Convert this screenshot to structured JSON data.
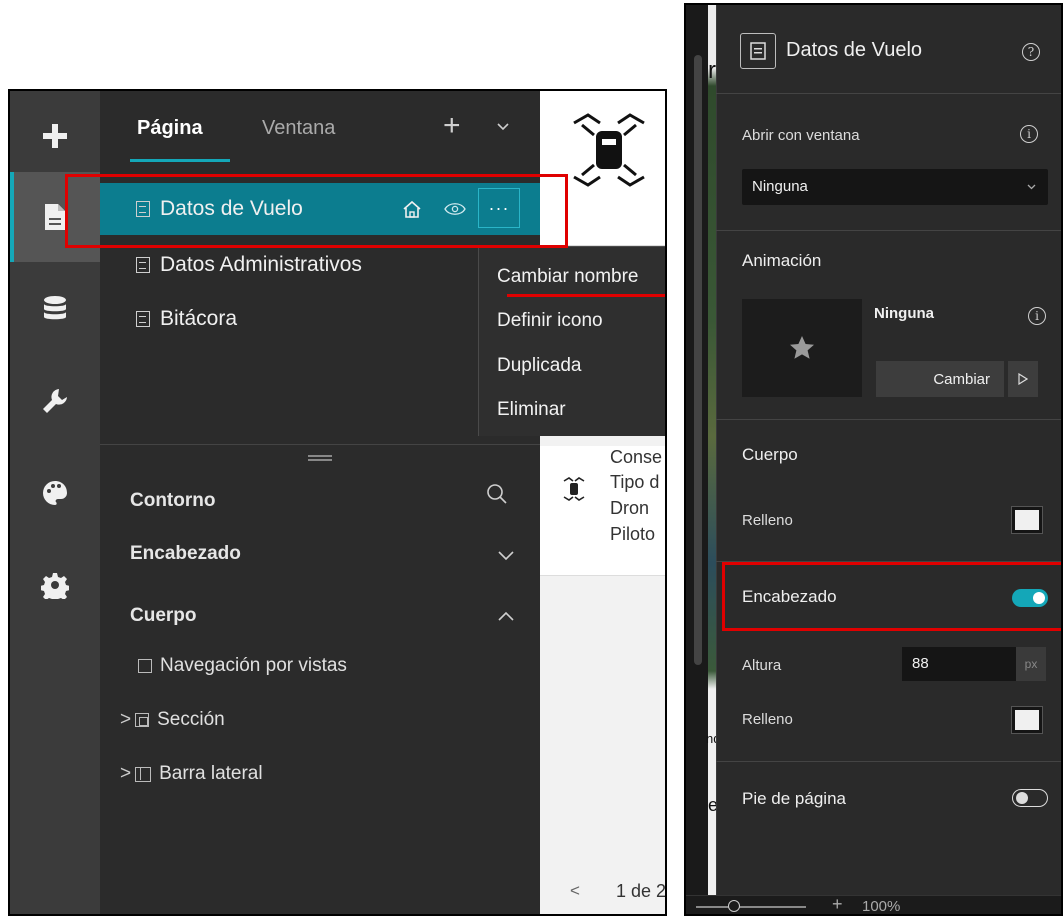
{
  "left_panel": {
    "tabs": {
      "page": "Página",
      "window": "Ventana"
    },
    "pages": [
      {
        "label": "Datos de Vuelo"
      },
      {
        "label": "Datos Administrativos"
      },
      {
        "label": "Bitácora"
      }
    ],
    "more_label": "···",
    "context_menu": [
      "Cambiar nombre",
      "Definir icono",
      "Duplicada",
      "Eliminar"
    ],
    "outline": {
      "title": "Contorno",
      "header": "Encabezado",
      "body": "Cuerpo",
      "items": [
        {
          "label": "Navegación por vistas"
        },
        {
          "label": "Sección"
        },
        {
          "label": "Barra lateral"
        }
      ]
    },
    "canvas": {
      "lines": [
        "Conse",
        "Tipo d",
        "Dron",
        "Piloto"
      ],
      "pager": "1 de 2",
      "pager_prev": "<"
    }
  },
  "right_panel": {
    "title": "Datos de Vuelo",
    "open_with_window": {
      "label": "Abrir con ventana",
      "value": "Ninguna"
    },
    "animation": {
      "label": "Animación",
      "value": "Ninguna",
      "change_button": "Cambiar"
    },
    "body": {
      "label": "Cuerpo",
      "fill_label": "Relleno"
    },
    "header": {
      "label": "Encabezado",
      "enabled": true,
      "height_label": "Altura",
      "height_value": "88",
      "height_unit": "px",
      "fill_label": "Relleno"
    },
    "footer": {
      "label": "Pie de página",
      "enabled": false
    },
    "map_edge_texts": [
      "r",
      "nd",
      "e"
    ],
    "zoom": "100%"
  },
  "colors": {
    "accent": "#14a7b8",
    "selected_row": "#0c7d8f",
    "highlight_red": "#e00000"
  }
}
